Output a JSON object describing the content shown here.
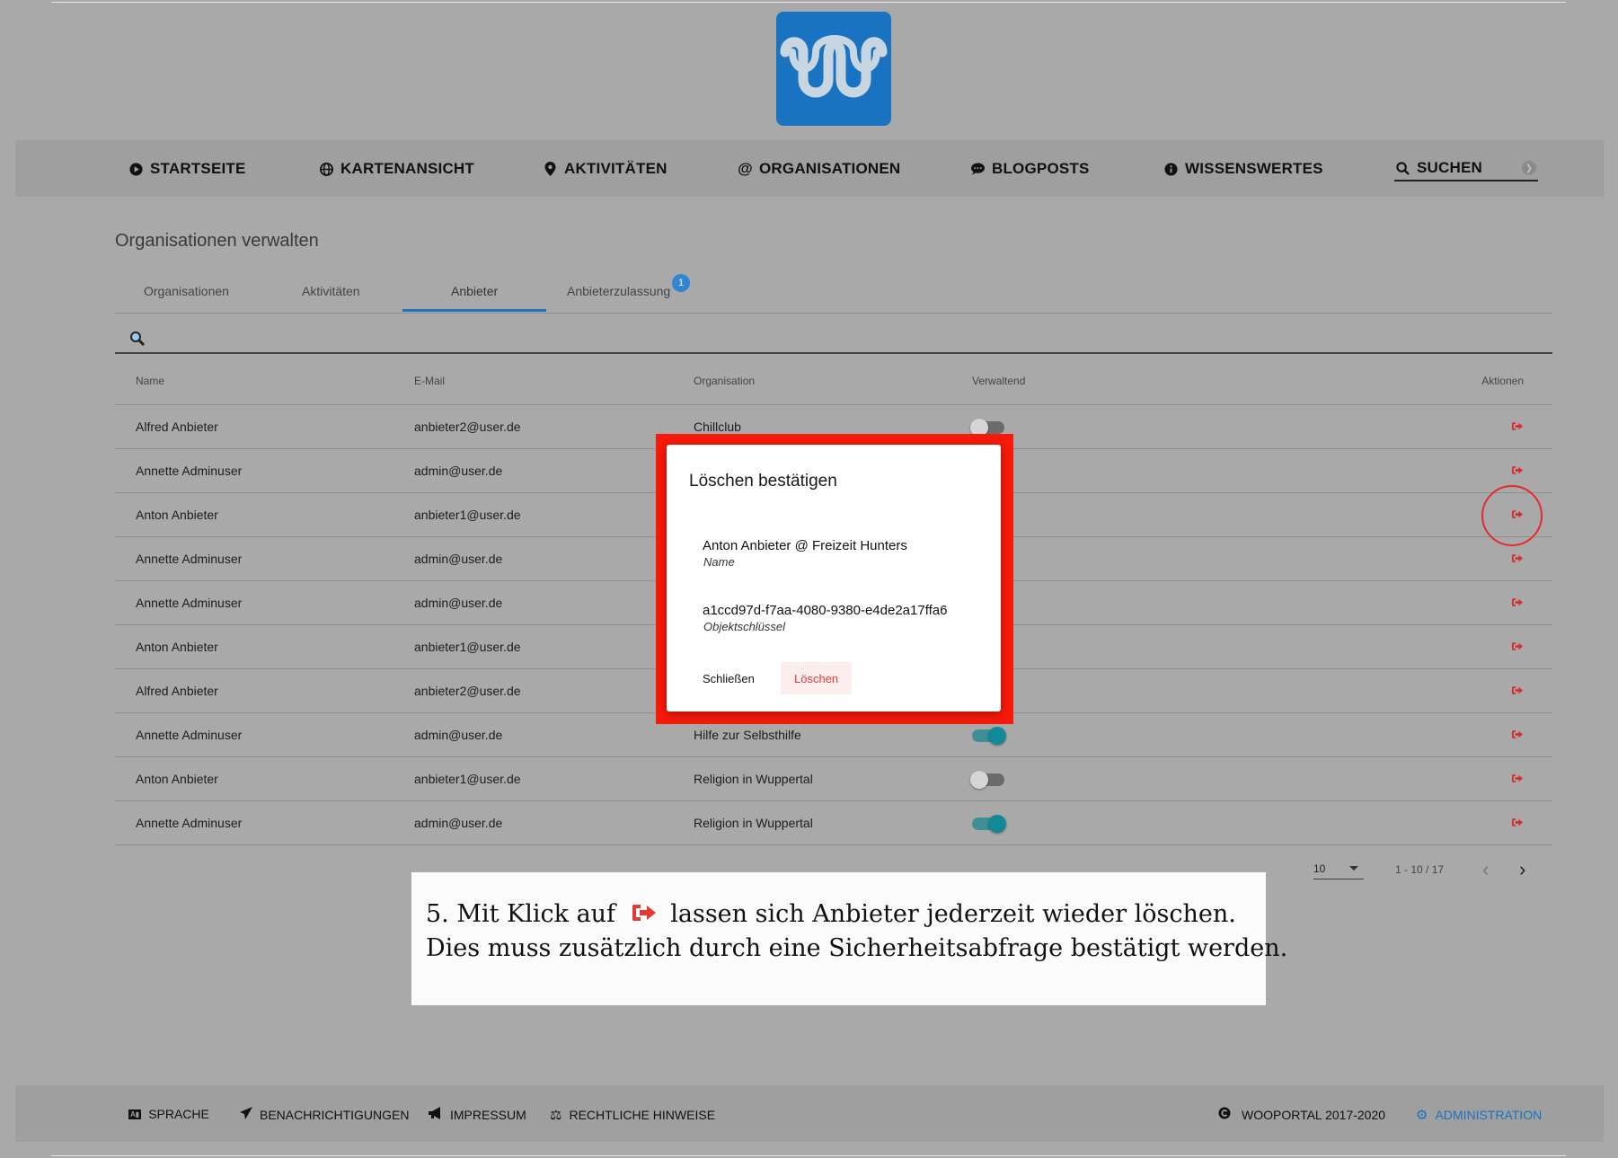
{
  "nav": {
    "items": [
      {
        "label": "STARTSEITE",
        "icon": "play-circle-icon"
      },
      {
        "label": "KARTENANSICHT",
        "icon": "globe-icon"
      },
      {
        "label": "AKTIVITÄTEN",
        "icon": "map-marker-icon"
      },
      {
        "label": "ORGANISATIONEN",
        "icon": "at-icon"
      },
      {
        "label": "BLOGPOSTS",
        "icon": "comment-icon"
      },
      {
        "label": "WISSENSWERTES",
        "icon": "info-icon"
      }
    ],
    "search_label": "SUCHEN"
  },
  "page": {
    "title": "Organisationen verwalten",
    "tabs": [
      "Organisationen",
      "Aktivitäten",
      "Anbieter",
      "Anbieterzulassung"
    ],
    "active_tab": "Anbieter",
    "badge": "1"
  },
  "table": {
    "columns": [
      "Name",
      "E-Mail",
      "Organisation",
      "Verwaltend",
      "Aktionen"
    ],
    "rows": [
      {
        "name": "Alfred Anbieter",
        "email": "anbieter2@user.de",
        "org": "Chillclub",
        "managing": false
      },
      {
        "name": "Annette Adminuser",
        "email": "admin@user.de",
        "org": "",
        "managing": true
      },
      {
        "name": "Anton Anbieter",
        "email": "anbieter1@user.de",
        "org": "",
        "managing": true
      },
      {
        "name": "Annette Adminuser",
        "email": "admin@user.de",
        "org": "",
        "managing": true
      },
      {
        "name": "Annette Adminuser",
        "email": "admin@user.de",
        "org": "",
        "managing": true
      },
      {
        "name": "Anton Anbieter",
        "email": "anbieter1@user.de",
        "org": "",
        "managing": true
      },
      {
        "name": "Alfred Anbieter",
        "email": "anbieter2@user.de",
        "org": "",
        "managing": true
      },
      {
        "name": "Annette Adminuser",
        "email": "admin@user.de",
        "org": "Hilfe zur Selbsthilfe",
        "managing": true
      },
      {
        "name": "Anton Anbieter",
        "email": "anbieter1@user.de",
        "org": "Religion in Wuppertal",
        "managing": false
      },
      {
        "name": "Annette Adminuser",
        "email": "admin@user.de",
        "org": "Religion in Wuppertal",
        "managing": true
      }
    ],
    "action_icon": "sign-out-icon"
  },
  "pagination": {
    "page_size": "10",
    "range": "1 - 10 / 17"
  },
  "dialog": {
    "title": "Löschen bestätigen",
    "name_value": "Anton Anbieter @ Freizeit Hunters",
    "name_label": "Name",
    "key_value": "a1ccd97d-f7aa-4080-9380-e4de2a17ffa6",
    "key_label": "Objektschlüssel",
    "close_label": "Schließen",
    "delete_label": "Löschen"
  },
  "caption": {
    "line1_pre": "5. Mit Klick auf",
    "line1_post": "lassen sich Anbieter jederzeit wieder löschen.",
    "line2": "Dies muss zusätzlich durch eine Sicherheitsabfrage bestätigt werden."
  },
  "footer": {
    "items": [
      {
        "label": "SPRACHE",
        "icon": "language-icon"
      },
      {
        "label": "BENACHRICHTIGUNGEN",
        "icon": "paper-plane-icon"
      },
      {
        "label": "IMPRESSUM",
        "icon": "bullhorn-icon"
      },
      {
        "label": "RECHTLICHE HINWEISE",
        "icon": "balance-scale-icon"
      }
    ],
    "copyright": "WOOPORTAL 2017-2020",
    "admin": "ADMINISTRATION"
  },
  "colors": {
    "brand": "#1a73c0",
    "danger": "#e53935",
    "highlight": "#f51a0a"
  }
}
